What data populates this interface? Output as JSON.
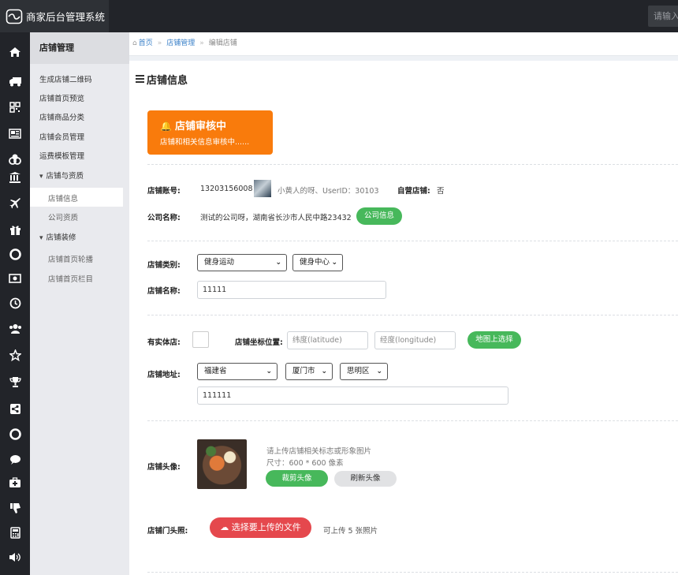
{
  "app": {
    "title": "商家后台管理系统",
    "search_placeholder": "请输入"
  },
  "rail_icons": [
    "home-icon",
    "truck-icon",
    "qrcode-icon",
    "newspaper-icon",
    "cube-icon",
    "bank-icon",
    "plane-icon",
    "gift-icon",
    "lifebuoy-icon",
    "money-icon",
    "clock-icon",
    "users-icon",
    "star-icon",
    "trophy-icon",
    "share-icon",
    "lifebuoy-icon",
    "comment-icon",
    "medkit-icon",
    "thumbs-down-icon",
    "calculator-icon",
    "volume-icon"
  ],
  "subnav": {
    "header": "店铺管理",
    "items": [
      {
        "label": "生成店铺二维码"
      },
      {
        "label": "店铺首页预览"
      },
      {
        "label": "店铺商品分类"
      },
      {
        "label": "店铺会员管理"
      },
      {
        "label": "运费模板管理"
      },
      {
        "label": "店铺与资质"
      },
      {
        "label": "店铺信息"
      },
      {
        "label": "公司资质"
      },
      {
        "label": "店铺装修"
      },
      {
        "label": "店铺首页轮播"
      },
      {
        "label": "店铺首页栏目"
      }
    ]
  },
  "breadcrumb": {
    "home": "首页",
    "level2": "店铺管理",
    "current": "编辑店铺"
  },
  "page": {
    "title": "店铺信息"
  },
  "alert": {
    "title": "店铺审核中",
    "desc": "店铺和相关信息审核中......"
  },
  "account": {
    "account_label": "店铺账号:",
    "account_value": "13203156008",
    "user_name": "小黄人的呀、UserID：30103",
    "self_label": "自营店铺:",
    "self_value": "否",
    "company_label": "公司名称:",
    "company_value": "测试的公司呀，湖南省长沙市人民中路23432",
    "company_btn": "公司信息"
  },
  "category": {
    "category_label": "店铺类别:",
    "category1": "健身运动",
    "category2": "健身中心",
    "name_label": "店铺名称:",
    "name_value": "11111"
  },
  "location": {
    "physical_label": "有实体店:",
    "coords_label": "店铺坐标位置:",
    "lat_placeholder": "纬度(latitude)",
    "lng_placeholder": "经度(longitude)",
    "map_btn": "地图上选择",
    "address_label": "店铺地址:",
    "province": "福建省",
    "city": "厦门市",
    "district": "思明区",
    "address_detail": "111111"
  },
  "avatar": {
    "label": "店铺头像:",
    "hint1": "请上传店铺相关标志或形象图片",
    "hint2": "尺寸：600 * 600 像素",
    "crop_btn": "裁剪头像",
    "refresh_btn": "刷新头像"
  },
  "door": {
    "label": "店铺门头照:",
    "upload_btn": "选择要上传的文件",
    "upload_hint": "可上传 5 张照片"
  },
  "colors": {
    "accent_orange": "#f97b0c",
    "green": "#47b85b",
    "red": "#e5484d",
    "dark": "#222429"
  }
}
